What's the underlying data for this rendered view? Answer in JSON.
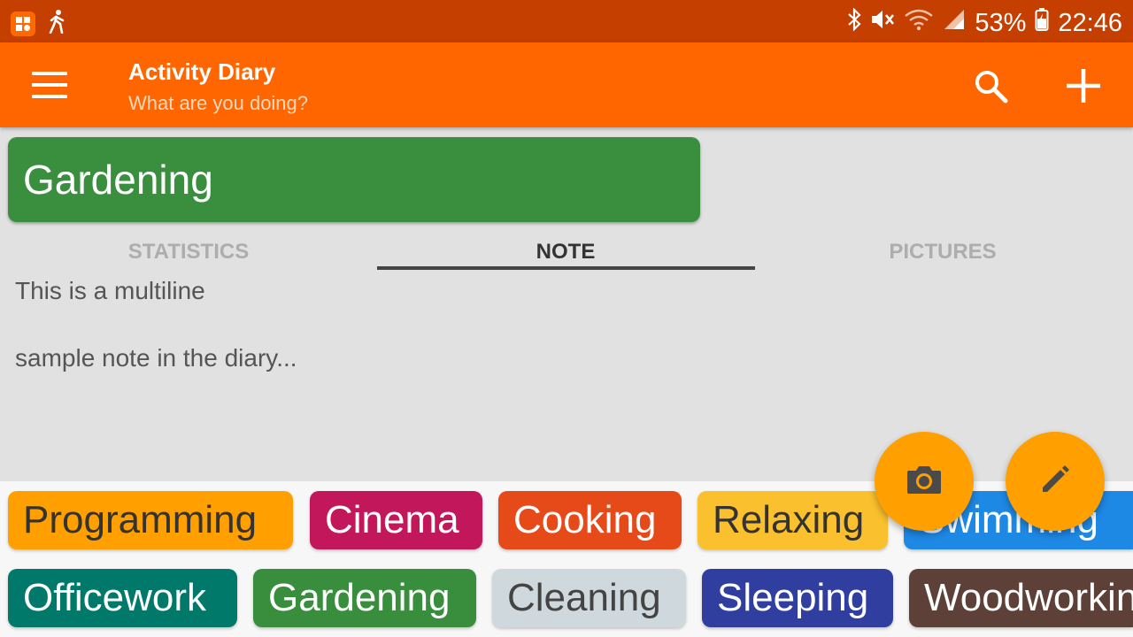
{
  "status_bar": {
    "battery": "53%",
    "time": "22:46"
  },
  "app_bar": {
    "title": "Activity Diary",
    "subtitle": "What are you doing?"
  },
  "current_activity": {
    "name": "Gardening",
    "color": "#3a8f3e"
  },
  "tabs": [
    {
      "label": "STATISTICS",
      "active": false
    },
    {
      "label": "NOTE",
      "active": true
    },
    {
      "label": "PICTURES",
      "active": false
    }
  ],
  "note": {
    "line1": "This is a multiline",
    "line2": "sample note in the diary..."
  },
  "activities_row1": [
    {
      "label": "Programming",
      "color": "#ffa000",
      "text_color": "#333333"
    },
    {
      "label": "Cinema",
      "color": "#c2185b",
      "text_color": "#ffffff"
    },
    {
      "label": "Cooking",
      "color": "#e64a19",
      "text_color": "#ffffff"
    },
    {
      "label": "Relaxing",
      "color": "#fbc02d",
      "text_color": "#333333"
    },
    {
      "label": "Swimming",
      "color": "#1e88e5",
      "text_color": "#ffffff"
    }
  ],
  "activities_row2": [
    {
      "label": "Officework",
      "color": "#00796b",
      "text_color": "#ffffff"
    },
    {
      "label": "Gardening",
      "color": "#388e3c",
      "text_color": "#ffffff"
    },
    {
      "label": "Cleaning",
      "color": "#cfd8dc",
      "text_color": "#444444"
    },
    {
      "label": "Sleeping",
      "color": "#303f9f",
      "text_color": "#ffffff"
    },
    {
      "label": "Woodworking",
      "color": "#5d4037",
      "text_color": "#ffffff"
    }
  ],
  "icons": {
    "menu": "menu-icon",
    "search": "search-icon",
    "add": "add-icon",
    "camera": "camera-icon",
    "edit": "edit-icon"
  },
  "colors": {
    "status_bar": "#c43f00",
    "app_bar": "#ff6600",
    "fab": "#ffa000"
  }
}
